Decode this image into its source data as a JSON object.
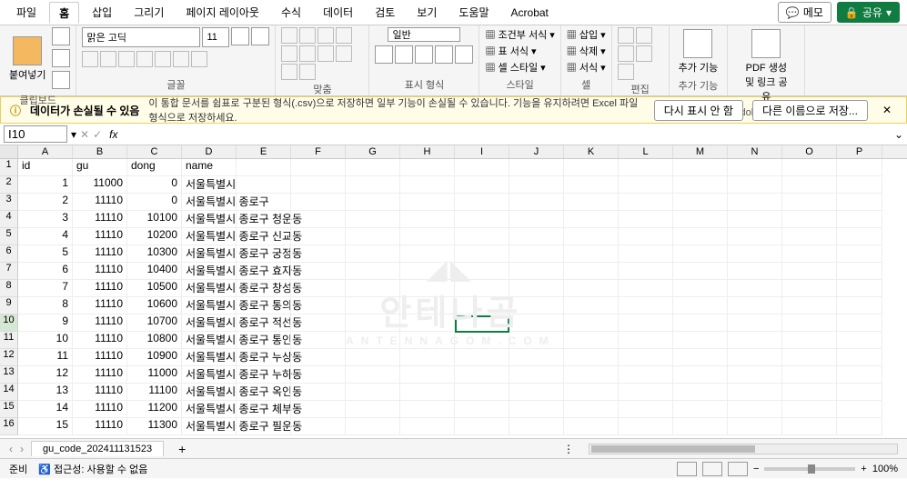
{
  "menu": {
    "items": [
      "파일",
      "홈",
      "삽입",
      "그리기",
      "페이지 레이아웃",
      "수식",
      "데이터",
      "검토",
      "보기",
      "도움말",
      "Acrobat"
    ],
    "active": 1,
    "memo": "메모",
    "share": "공유"
  },
  "ribbon": {
    "clipboard": {
      "paste": "붙여넣기",
      "label": "클립보드"
    },
    "font": {
      "name": "맑은 고딕",
      "size": "11",
      "label": "글꼴"
    },
    "align": {
      "label": "맞춤"
    },
    "number": {
      "fmt": "일반",
      "label": "표시 형식"
    },
    "styles": {
      "cond": "조건부 서식",
      "table": "표 서식",
      "cell": "셀 스타일",
      "label": "스타일"
    },
    "cells": {
      "insert": "삽입",
      "delete": "삭제",
      "format": "서식",
      "label": "셀"
    },
    "editing": {
      "label": "편집"
    },
    "addins": {
      "addin": "추가 기능",
      "label": "추가 기능"
    },
    "acrobat": {
      "pdf": "PDF 생성 및 링크 공유",
      "label": "Adobe Acrobat"
    }
  },
  "warn": {
    "title": "데이터가 손실될 수 있음",
    "text": "이 통합 문서를 쉼표로 구분된 형식(.csv)으로 저장하면 일부 기능이 손실될 수 있습니다. 기능을 유지하려면 Excel 파일 형식으로 저장하세요.",
    "btn1": "다시 표시 안 함",
    "btn2": "다른 이름으로 저장..."
  },
  "fbar": {
    "cell": "I10",
    "fx": "fx"
  },
  "cols": [
    "A",
    "B",
    "C",
    "D",
    "E",
    "F",
    "G",
    "H",
    "I",
    "J",
    "K",
    "L",
    "M",
    "N",
    "O",
    "P"
  ],
  "headers": {
    "A": "id",
    "B": "gu",
    "C": "dong",
    "D": "name"
  },
  "rows": [
    {
      "n": 1,
      "A": "id",
      "B": "gu",
      "C": "dong",
      "D": "name"
    },
    {
      "n": 2,
      "A": "1",
      "B": "11000",
      "C": "0",
      "D": "서울특별시"
    },
    {
      "n": 3,
      "A": "2",
      "B": "11110",
      "C": "0",
      "D": "서울특별시 종로구"
    },
    {
      "n": 4,
      "A": "3",
      "B": "11110",
      "C": "10100",
      "D": "서울특별시 종로구 청운동"
    },
    {
      "n": 5,
      "A": "4",
      "B": "11110",
      "C": "10200",
      "D": "서울특별시 종로구 신교동"
    },
    {
      "n": 6,
      "A": "5",
      "B": "11110",
      "C": "10300",
      "D": "서울특별시 종로구 궁정동"
    },
    {
      "n": 7,
      "A": "6",
      "B": "11110",
      "C": "10400",
      "D": "서울특별시 종로구 효자동"
    },
    {
      "n": 8,
      "A": "7",
      "B": "11110",
      "C": "10500",
      "D": "서울특별시 종로구 창성동"
    },
    {
      "n": 9,
      "A": "8",
      "B": "11110",
      "C": "10600",
      "D": "서울특별시 종로구 통의동"
    },
    {
      "n": 10,
      "A": "9",
      "B": "11110",
      "C": "10700",
      "D": "서울특별시 종로구 적선동"
    },
    {
      "n": 11,
      "A": "10",
      "B": "11110",
      "C": "10800",
      "D": "서울특별시 종로구 통인동"
    },
    {
      "n": 12,
      "A": "11",
      "B": "11110",
      "C": "10900",
      "D": "서울특별시 종로구 누상동"
    },
    {
      "n": 13,
      "A": "12",
      "B": "11110",
      "C": "11000",
      "D": "서울특별시 종로구 누하동"
    },
    {
      "n": 14,
      "A": "13",
      "B": "11110",
      "C": "11100",
      "D": "서울특별시 종로구 옥인동"
    },
    {
      "n": 15,
      "A": "14",
      "B": "11110",
      "C": "11200",
      "D": "서울특별시 종로구 체부동"
    },
    {
      "n": 16,
      "A": "15",
      "B": "11110",
      "C": "11300",
      "D": "서울특별시 종로구 필운동"
    }
  ],
  "active": {
    "row": 10,
    "col": "I"
  },
  "tabs": {
    "sheet": "gu_code_202411131523"
  },
  "status": {
    "ready": "준비",
    "access": "접근성: 사용할 수 없음",
    "zoom": "100%"
  },
  "watermark": {
    "kr": "안테나곰",
    "en": "ANTENNAGOM.COM"
  }
}
